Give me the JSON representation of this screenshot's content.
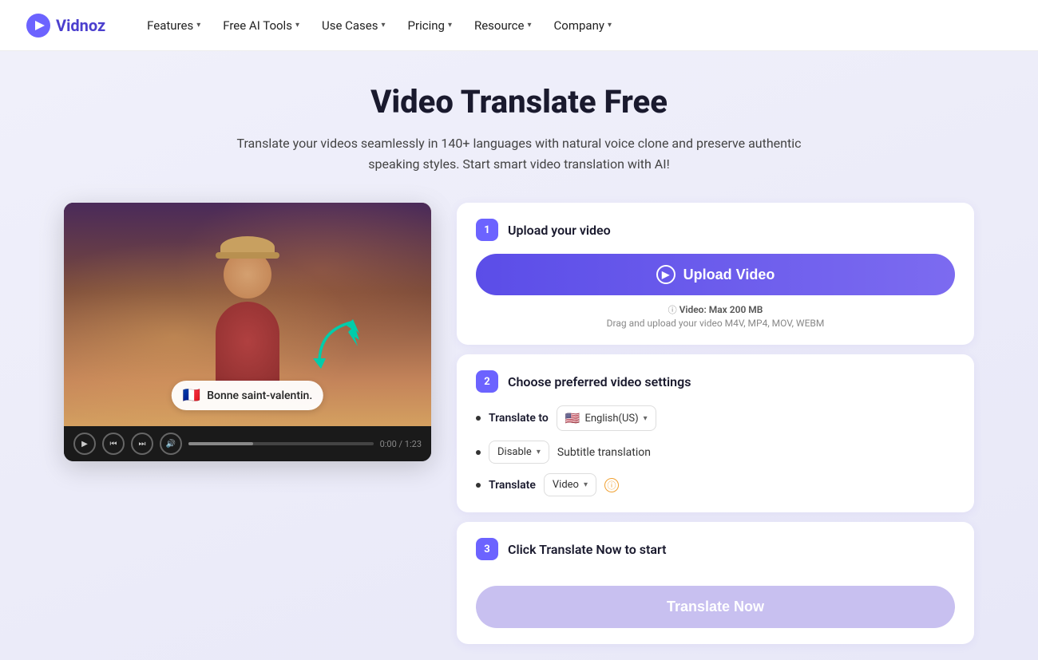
{
  "brand": {
    "name": "Vidnoz",
    "logo_text": "Vidnoz"
  },
  "nav": {
    "items": [
      {
        "label": "Features",
        "has_dropdown": true
      },
      {
        "label": "Free AI Tools",
        "has_dropdown": true
      },
      {
        "label": "Use Cases",
        "has_dropdown": true
      },
      {
        "label": "Pricing",
        "has_dropdown": true
      },
      {
        "label": "Resource",
        "has_dropdown": true
      },
      {
        "label": "Company",
        "has_dropdown": true
      }
    ]
  },
  "hero": {
    "title": "Video Translate Free",
    "subtitle": "Translate your videos seamlessly in 140+ languages with natural voice clone and preserve authentic speaking styles. Start smart video translation with AI!"
  },
  "video": {
    "subtitle_flag": "🇫🇷",
    "subtitle_text": "Bonne saint-valentin.",
    "time": "0:00 / 1:23"
  },
  "steps": {
    "step1": {
      "badge": "1",
      "title": "Upload your video",
      "upload_button_label": "Upload Video",
      "file_size_label": "Video: Max 200 MB",
      "drag_label": "Drag and upload your video M4V, MP4, MOV, WEBM"
    },
    "step2": {
      "badge": "2",
      "title": "Choose preferred video settings",
      "translate_to_label": "Translate to",
      "language_flag": "🇺🇸",
      "language_label": "English(US)",
      "subtitle_select_label": "Disable",
      "subtitle_translation_label": "Subtitle translation",
      "translate_label": "Translate",
      "translate_mode": "Video"
    },
    "step3": {
      "badge": "3",
      "title": "Click Translate Now to start",
      "button_label": "Translate Now"
    }
  }
}
